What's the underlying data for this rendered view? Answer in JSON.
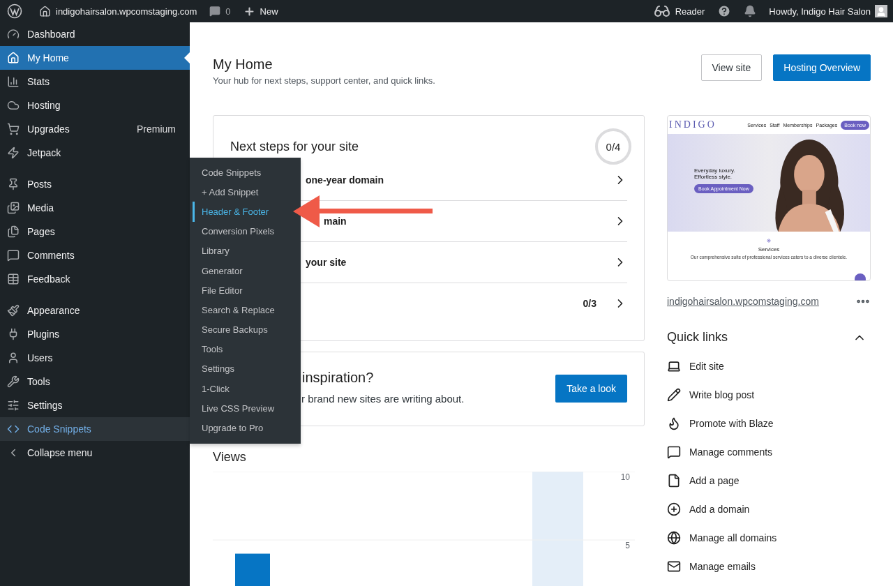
{
  "admin_bar": {
    "site": "indigohairsalon.wpcomstaging.com",
    "comments": "0",
    "new": "New",
    "reader": "Reader",
    "greeting": "Howdy, Indigo Hair Salon"
  },
  "sidebar": {
    "groups": [
      [
        {
          "label": "Dashboard",
          "selected": false,
          "open": false
        },
        {
          "label": "My Home",
          "selected": true,
          "open": false
        },
        {
          "label": "Stats",
          "selected": false,
          "open": false
        },
        {
          "label": "Hosting",
          "selected": false,
          "open": false
        },
        {
          "label": "Upgrades",
          "badge": "Premium",
          "selected": false,
          "open": false
        },
        {
          "label": "Jetpack",
          "selected": false,
          "open": false
        }
      ],
      [
        {
          "label": "Posts",
          "selected": false,
          "open": false
        },
        {
          "label": "Media",
          "selected": false,
          "open": false
        },
        {
          "label": "Pages",
          "selected": false,
          "open": false
        },
        {
          "label": "Comments",
          "selected": false,
          "open": false
        },
        {
          "label": "Feedback",
          "selected": false,
          "open": false
        }
      ],
      [
        {
          "label": "Appearance",
          "selected": false,
          "open": false
        },
        {
          "label": "Plugins",
          "selected": false,
          "open": false
        },
        {
          "label": "Users",
          "selected": false,
          "open": false
        },
        {
          "label": "Tools",
          "selected": false,
          "open": false
        },
        {
          "label": "Settings",
          "selected": false,
          "open": false
        },
        {
          "label": "Code Snippets",
          "selected": false,
          "open": true
        },
        {
          "label": "Collapse menu",
          "selected": false,
          "open": false
        }
      ]
    ]
  },
  "flyout": {
    "items": [
      {
        "label": "Code Snippets",
        "selected": false
      },
      {
        "label": "+ Add Snippet",
        "selected": false
      },
      {
        "label": "Header & Footer",
        "selected": true
      },
      {
        "label": "Conversion Pixels",
        "selected": false
      },
      {
        "label": "Library",
        "selected": false
      },
      {
        "label": "Generator",
        "selected": false
      },
      {
        "label": "File Editor",
        "selected": false
      },
      {
        "label": "Search & Replace",
        "selected": false
      },
      {
        "label": "Secure Backups",
        "selected": false
      },
      {
        "label": "Tools",
        "selected": false
      },
      {
        "label": "Settings",
        "selected": false
      },
      {
        "label": "1-Click",
        "selected": false
      },
      {
        "label": "Live CSS Preview",
        "selected": false
      },
      {
        "label": "Upgrade to Pro",
        "selected": false
      }
    ]
  },
  "header": {
    "title": "My Home",
    "subtitle": "Your hub for next steps, support center, and quick links.",
    "buttons": [
      {
        "label": "View site",
        "kind": "secondary"
      },
      {
        "label": "Hosting Overview",
        "kind": "primary"
      }
    ]
  },
  "next_steps": {
    "title": "Next steps for your site",
    "progress": "0/4",
    "rows": [
      {
        "text": "one-year domain"
      },
      {
        "text": "main"
      },
      {
        "text": "your site"
      },
      {
        "count": "0/3"
      }
    ]
  },
  "inspiration": {
    "title": "inspiration?",
    "text": "r brand new sites are writing about.",
    "button": "Take a look"
  },
  "views": {
    "title": "Views",
    "chart_data": {
      "type": "bar",
      "values": [
        4,
        0,
        0,
        0,
        0,
        0,
        0
      ],
      "ylim": [
        0,
        10
      ],
      "yticks": [
        5,
        10
      ]
    }
  },
  "site_preview": {
    "logo": "INDIGO",
    "nav": [
      "Services",
      "Staff",
      "Memberships",
      "Packages"
    ],
    "nav_button": "Book now",
    "headline": "Everyday luxury.",
    "headline_2": "Effortless style.",
    "cta": "Book Appointment Now",
    "section_title": "Services",
    "section_text": "Our comprehensive suite of professional services caters to a diverse clientele.",
    "url": "indigohairsalon.wpcomstaging.com"
  },
  "quick_links": {
    "title": "Quick links",
    "expanded": true,
    "items": [
      {
        "label": "Edit site"
      },
      {
        "label": "Write blog post"
      },
      {
        "label": "Promote with Blaze"
      },
      {
        "label": "Manage comments"
      },
      {
        "label": "Add a page"
      },
      {
        "label": "Add a domain"
      },
      {
        "label": "Manage all domains"
      },
      {
        "label": "Manage emails"
      }
    ]
  }
}
